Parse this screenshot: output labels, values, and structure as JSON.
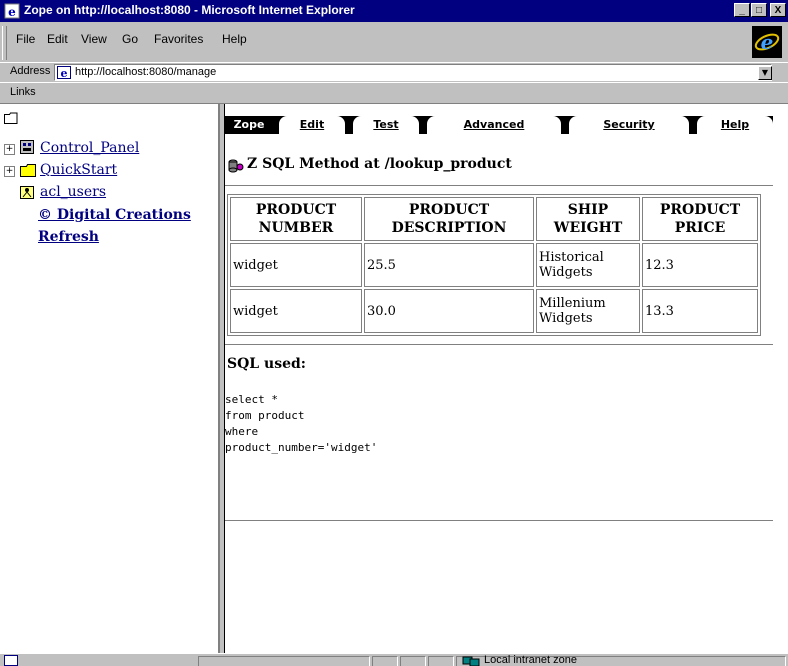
{
  "window": {
    "title": "Zope on http://localhost:8080 - Microsoft Internet Explorer",
    "minimize": "_",
    "maximize": "□",
    "close": "X"
  },
  "menu": {
    "items": [
      "File",
      "Edit",
      "View",
      "Go",
      "Favorites",
      "Help"
    ]
  },
  "address": {
    "label": "Address",
    "url": "http://localhost:8080/manage"
  },
  "links": {
    "label": "Links"
  },
  "tree": {
    "control_panel": "Control_Panel",
    "quickstart": "QuickStart",
    "acl_users": "acl_users",
    "digital_creations": "© Digital Creations",
    "refresh": "Refresh"
  },
  "tabs": {
    "zope": "Zope",
    "items": [
      "Edit",
      "Test",
      "Advanced",
      "Security",
      "Help"
    ],
    "active": "Edit"
  },
  "page": {
    "heading": "Z SQL Method at /lookup_product"
  },
  "results": {
    "headers": [
      [
        "PRODUCT",
        "NUMBER"
      ],
      [
        "PRODUCT",
        "DESCRIPTION"
      ],
      [
        "SHIP",
        "WEIGHT"
      ],
      [
        "PRODUCT",
        "PRICE"
      ]
    ],
    "rows": [
      [
        "widget",
        "25.5",
        "Historical Widgets",
        "12.3"
      ],
      [
        "widget",
        "30.0",
        "Millenium Widgets",
        "13.3"
      ]
    ]
  },
  "sql": {
    "heading": "SQL used:",
    "query": "select *\nfrom product\nwhere\nproduct_number='widget'"
  },
  "status": {
    "zone": "Local intranet zone"
  },
  "colors": {
    "titlebar": "#000080",
    "chrome": "#c0c0c0",
    "link": "#000080"
  }
}
